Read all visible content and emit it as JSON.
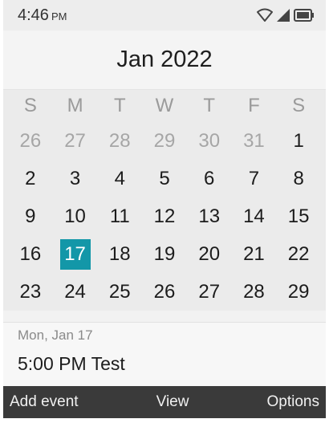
{
  "status_bar": {
    "time": "4:46",
    "ampm": "PM",
    "icons": [
      "wifi-icon",
      "signal-icon",
      "battery-icon"
    ]
  },
  "calendar": {
    "month_title": "Jan 2022",
    "weekdays": [
      "S",
      "M",
      "T",
      "W",
      "T",
      "F",
      "S"
    ],
    "weeks": [
      [
        "26",
        "27",
        "28",
        "29",
        "30",
        "31",
        "1"
      ],
      [
        "2",
        "3",
        "4",
        "5",
        "6",
        "7",
        "8"
      ],
      [
        "9",
        "10",
        "11",
        "12",
        "13",
        "14",
        "15"
      ],
      [
        "16",
        "17",
        "18",
        "19",
        "20",
        "21",
        "22"
      ],
      [
        "23",
        "24",
        "25",
        "26",
        "27",
        "28",
        "29"
      ]
    ],
    "selected_day": "17",
    "accent_color": "#1397a8"
  },
  "event_panel": {
    "date_label": "Mon, Jan 17",
    "event_text": "5:00 PM Test"
  },
  "softkeys": {
    "left": "Add event",
    "center": "View",
    "right": "Options"
  }
}
